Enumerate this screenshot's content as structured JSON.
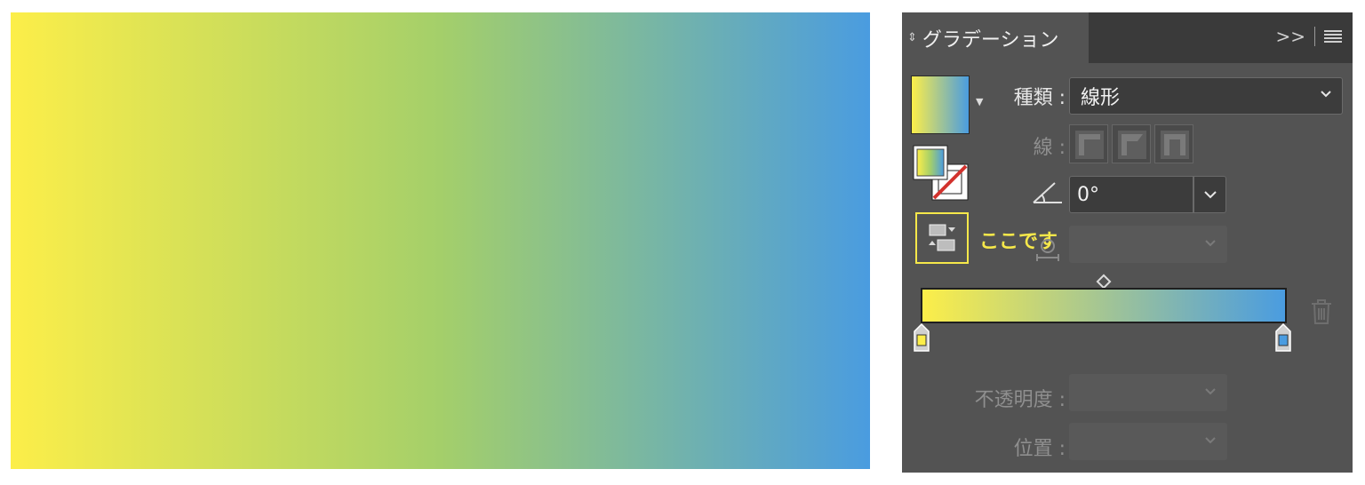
{
  "colors": {
    "gradient_start": "#fcee49",
    "gradient_mid": "#a4cf6a",
    "gradient_end": "#4a9ce0",
    "annotation": "#f6e84a"
  },
  "panel": {
    "tab_arrow_icon": "up-down-arrows-icon",
    "title": "グラデーション",
    "expand_label": ">>",
    "menu_icon": "hamburger-icon"
  },
  "fields": {
    "type_label": "種類 :",
    "type_value": "線形",
    "stroke_label": "線 :",
    "angle_icon": "angle-icon",
    "angle_value": "0°",
    "aspect_icon": "aspect-ratio-icon",
    "aspect_value": "",
    "opacity_label": "不透明度 :",
    "opacity_value": "",
    "position_label": "位置 :",
    "position_value": ""
  },
  "annotation": {
    "text": "ここです"
  },
  "slider": {
    "stops": [
      {
        "color": "#fcee49",
        "location": 0
      },
      {
        "color": "#4a9ce0",
        "location": 100
      }
    ],
    "midpoint": 50
  }
}
